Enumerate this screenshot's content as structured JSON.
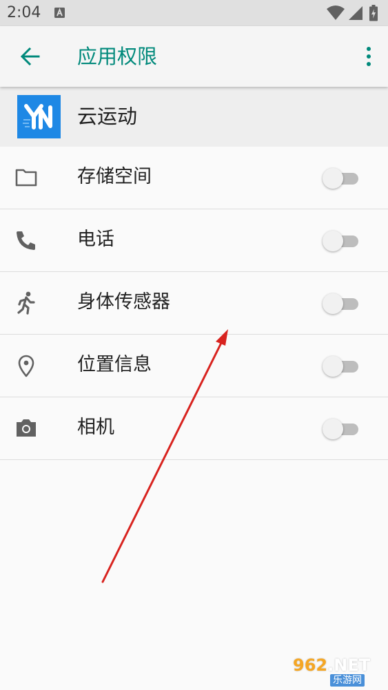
{
  "status_bar": {
    "time": "2:04",
    "notification_icons": [
      "a-notification-icon"
    ],
    "system_icons": [
      "wifi-icon",
      "cellular-signal-icon",
      "battery-charging-icon"
    ]
  },
  "toolbar": {
    "back_icon": "arrow-back-icon",
    "title": "应用权限",
    "menu_icon": "more-vert-icon"
  },
  "app": {
    "name": "云运动",
    "icon": "app-logo-yn-icon",
    "icon_color": "#1e88e5"
  },
  "permissions": [
    {
      "label": "存储空间",
      "icon": "folder-icon",
      "enabled": false
    },
    {
      "label": "电话",
      "icon": "phone-icon",
      "enabled": false
    },
    {
      "label": "身体传感器",
      "icon": "running-person-icon",
      "enabled": false
    },
    {
      "label": "位置信息",
      "icon": "location-pin-icon",
      "enabled": false
    },
    {
      "label": "相机",
      "icon": "camera-icon",
      "enabled": false
    }
  ],
  "watermark": {
    "logo": "962.NET",
    "logo_number": "962",
    "logo_suffix": ".NET",
    "subtitle": "乐游网"
  },
  "colors": {
    "accent": "#00897b",
    "status_bar": "#e0e0e0",
    "toolbar": "#f5f5f5",
    "app_header": "#eeeeee",
    "background": "#fafafa",
    "annotation_arrow": "#e0201e"
  }
}
